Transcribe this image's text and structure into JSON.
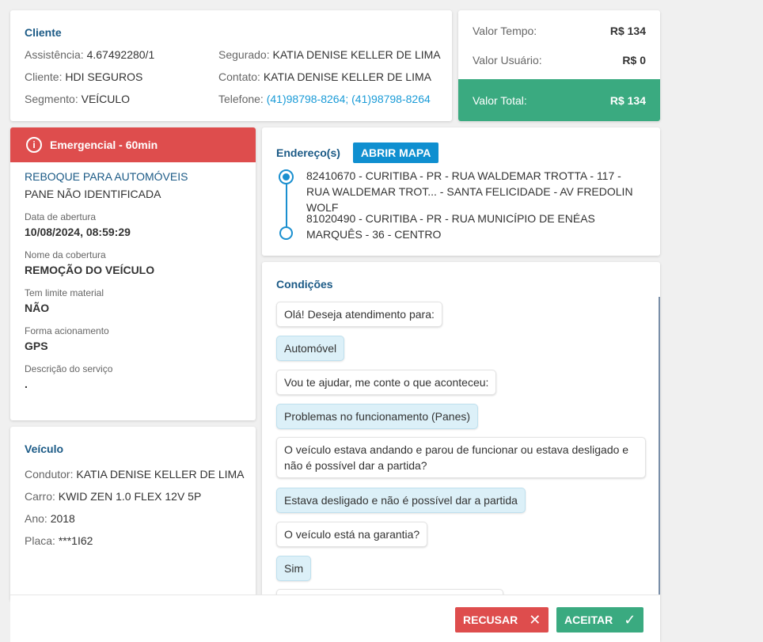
{
  "cliente": {
    "title": "Cliente",
    "assistencia_label": "Assistência:",
    "assistencia_value": "4.67492280/1",
    "cliente_label": "Cliente:",
    "cliente_value": "HDI SEGUROS",
    "segmento_label": "Segmento:",
    "segmento_value": "VEÍCULO",
    "segurado_label": "Segurado:",
    "segurado_value": "KATIA DENISE KELLER DE LIMA",
    "contato_label": "Contato:",
    "contato_value": "KATIA DENISE KELLER DE LIMA",
    "telefone_label": "Telefone:",
    "telefone_value": "(41)98798-8264; (41)98798-8264"
  },
  "valores": {
    "tempo_label": "Valor Tempo:",
    "tempo_value": "R$ 134",
    "usuario_label": "Valor Usuário:",
    "usuario_value": "R$ 0",
    "total_label": "Valor Total:",
    "total_value": "R$ 134",
    "total_color": "#3aaa80"
  },
  "servico": {
    "banner": "Emergencial - 60min",
    "banner_icon": "info-icon",
    "banner_color": "#de4d4d",
    "title": "REBOQUE PARA AUTOMÓVEIS",
    "subtitle": "PANE NÃO IDENTIFICADA",
    "fields": [
      {
        "label": "Data de abertura",
        "value": "10/08/2024, 08:59:29"
      },
      {
        "label": "Nome da cobertura",
        "value": "REMOÇÃO DO VEÍCULO"
      },
      {
        "label": "Tem limite material",
        "value": "NÃO"
      },
      {
        "label": "Forma acionamento",
        "value": "GPS"
      },
      {
        "label": "Descrição do serviço",
        "value": "."
      }
    ]
  },
  "veiculo": {
    "title": "Veículo",
    "condutor_label": "Condutor:",
    "condutor_value": "KATIA DENISE KELLER DE LIMA",
    "carro_label": "Carro:",
    "carro_value": "KWID ZEN 1.0 FLEX 12V 5P",
    "ano_label": "Ano:",
    "ano_value": "2018",
    "placa_label": "Placa:",
    "placa_value": "***1I62"
  },
  "enderecos": {
    "title": "Endereço(s)",
    "map_button": "ABRIR MAPA",
    "origin": "82410670 - CURITIBA - PR - RUA WALDEMAR TROTTA - 117 - RUA WALDEMAR TROT... - SANTA FELICIDADE - AV FREDOLIN WOLF",
    "destination": "81020490 - CURITIBA - PR - RUA MUNICÍPIO DE ENÉAS MARQUÊS - 36 - CENTRO"
  },
  "condicoes": {
    "title": "Condições",
    "messages": [
      {
        "type": "q",
        "text": "Olá! Deseja atendimento para:"
      },
      {
        "type": "a",
        "text": "Automóvel"
      },
      {
        "type": "q",
        "text": "Vou te ajudar, me conte o que aconteceu:"
      },
      {
        "type": "a",
        "text": "Problemas no funcionamento (Panes)"
      },
      {
        "type": "q",
        "text": "O veículo estava andando e parou de funcionar ou estava desligado e não é possível dar a partida?"
      },
      {
        "type": "a",
        "text": "Estava desligado e não é possível dar a partida"
      },
      {
        "type": "q",
        "text": "O veículo está na garantia?"
      },
      {
        "type": "a",
        "text": "Sim"
      }
    ]
  },
  "footer": {
    "recusar": "RECUSAR",
    "recusar_icon": "close-icon",
    "aceitar": "ACEITAR",
    "aceitar_icon": "check-icon"
  }
}
